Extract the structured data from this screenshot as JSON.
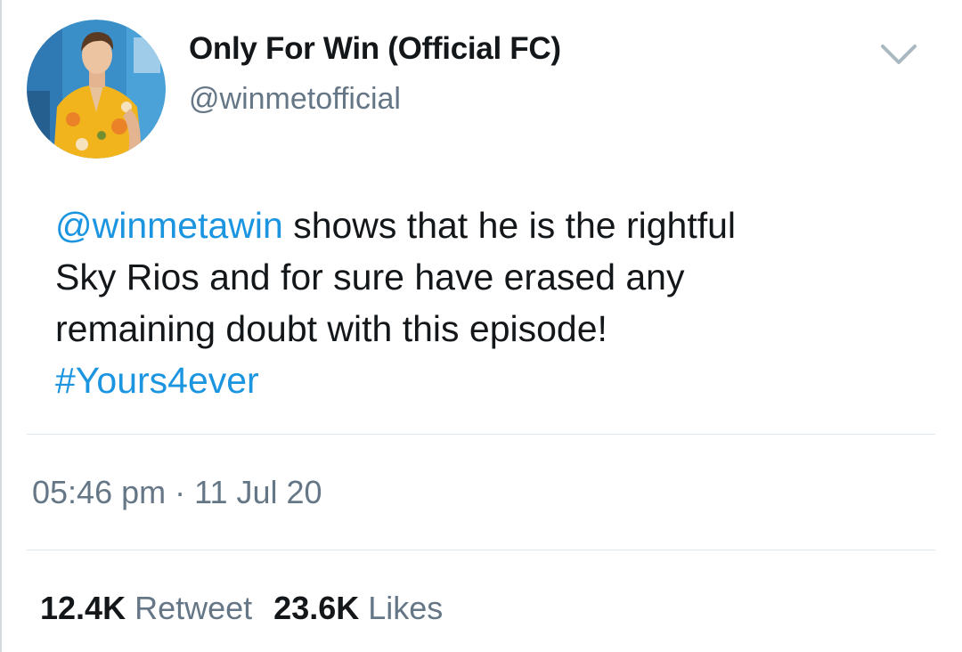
{
  "account": {
    "display_name": "Only For Win (Official FC)",
    "handle": "@winmetofficial"
  },
  "tweet": {
    "mention": "@winmetawin",
    "line1_rest": " shows that he is the rightful",
    "line2": "Sky Rios and for sure have erased any",
    "line3": "remaining doubt with this episode!",
    "hashtag": "#Yours4ever",
    "time": "05:46 pm",
    "separator": " · ",
    "date": "11 Jul 20"
  },
  "stats": {
    "retweet_count": "12.4K",
    "retweet_label": "Retweet",
    "likes_count": "23.6K",
    "likes_label": "Likes"
  },
  "icons": {
    "menu": "chevron-down-icon"
  },
  "colors": {
    "link": "#1b95e0",
    "secondary_text": "#657786",
    "primary_text": "#14171a",
    "divider": "#e1e8ed"
  }
}
